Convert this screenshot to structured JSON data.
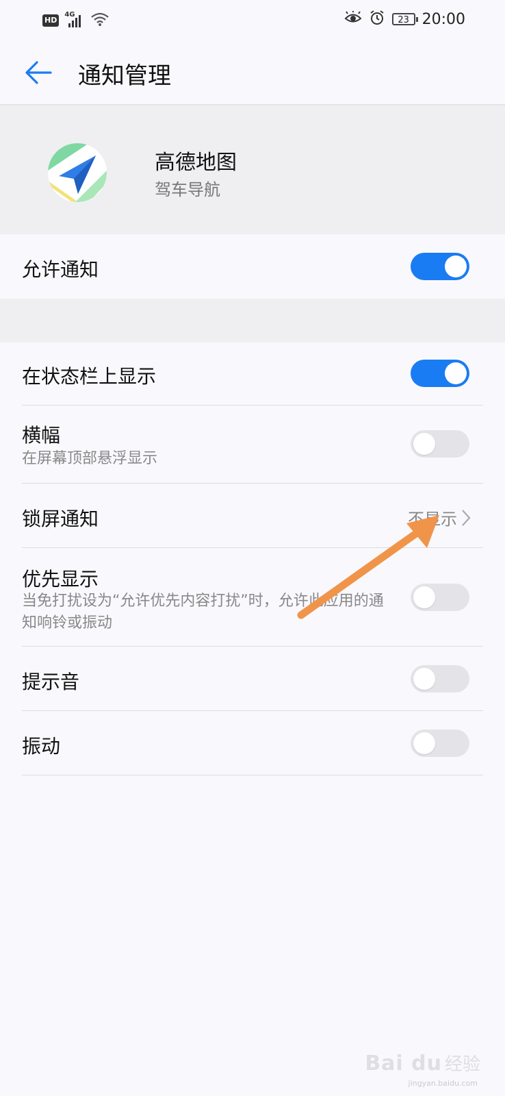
{
  "status_bar": {
    "hd_badge": "HD",
    "network_type": "4G",
    "battery_level": "23",
    "time": "20:00",
    "icons": [
      "hd-icon",
      "signal-icon",
      "wifi-icon",
      "eye-comfort-icon",
      "alarm-icon",
      "battery-icon"
    ]
  },
  "header": {
    "back_icon": "arrow-left-icon",
    "title": "通知管理"
  },
  "app": {
    "name": "高德地图",
    "subtitle": "驾车导航",
    "icon": "amap-app-icon"
  },
  "settings": {
    "allow_notifications": {
      "label": "允许通知",
      "enabled": true
    },
    "status_bar_display": {
      "label": "在状态栏上显示",
      "enabled": true
    },
    "banner": {
      "label": "横幅",
      "description": "在屏幕顶部悬浮显示",
      "enabled": false
    },
    "lock_screen": {
      "label": "锁屏通知",
      "value": "不显示",
      "icon": "chevron-right-icon"
    },
    "priority_display": {
      "label": "优先显示",
      "description": "当免打扰设为“允许优先内容打扰”时，允许此应用的通知响铃或振动",
      "enabled": false
    },
    "sound": {
      "label": "提示音",
      "enabled": false
    },
    "vibration": {
      "label": "振动",
      "enabled": false
    }
  },
  "colors": {
    "accent": "#1a7cf2",
    "toggle_off": "#e4e3e7",
    "annotation_arrow": "#f0944a",
    "background": "#f9f8fc",
    "section_gap": "#efeef1"
  },
  "watermark": {
    "logo": "Bai du",
    "text": "经验",
    "url": "jingyan.baidu.com"
  }
}
